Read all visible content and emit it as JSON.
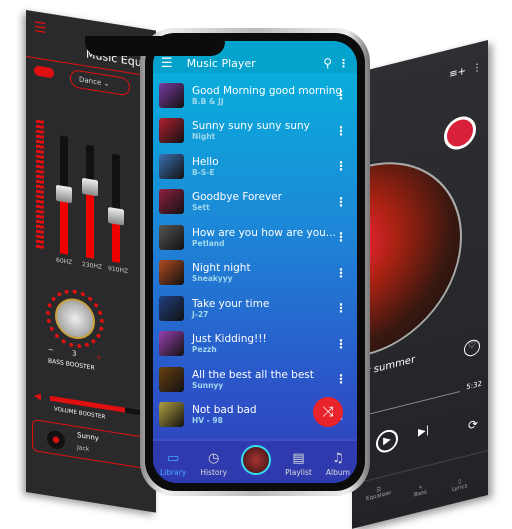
{
  "equalizer": {
    "title": "Music Equal",
    "preset": "Dance",
    "bands": [
      "60HZ",
      "230HZ",
      "910HZ"
    ],
    "band_toggles": [
      "ON",
      "ON",
      "ON"
    ],
    "bass_label": "BASS BOOSTER",
    "bass_value": "3",
    "bass_minus": "−",
    "bass_plus": "+",
    "volume_label": "VOLUME BOOSTER",
    "volume_level": 0.75,
    "now_playing": {
      "title": "Sunny",
      "artist": "Jack"
    },
    "accent": "#e01010"
  },
  "player": {
    "title": "Music Player",
    "songs": [
      {
        "title": "Good Morning good morning",
        "artist": "B.B & JJ"
      },
      {
        "title": "Sunny suny suny suny",
        "artist": "Night"
      },
      {
        "title": "Hello",
        "artist": "B-S-E"
      },
      {
        "title": "Goodbye Forever",
        "artist": "Sett"
      },
      {
        "title": "How are you how are you...",
        "artist": "Petland"
      },
      {
        "title": "Night night",
        "artist": "Sneakyyy"
      },
      {
        "title": "Take your time",
        "artist": "J-27"
      },
      {
        "title": "Just Kidding!!!",
        "artist": "Pezzh"
      },
      {
        "title": "All the best all the best",
        "artist": "Sunnyy"
      },
      {
        "title": "Not bad bad",
        "artist": "HV - 98"
      }
    ],
    "nav": [
      {
        "label": "Library",
        "icon": "folder-icon"
      },
      {
        "label": "History",
        "icon": "clock-icon"
      },
      {
        "label": "Playlist",
        "icon": "playlist-icon"
      },
      {
        "label": "Album",
        "icon": "album-icon"
      }
    ],
    "shuffle_color": "#e8232b"
  },
  "now_playing": {
    "title": "ner summer",
    "time": "5:32",
    "nav": [
      "Equalizer",
      "Bass",
      "Lyrics"
    ]
  }
}
